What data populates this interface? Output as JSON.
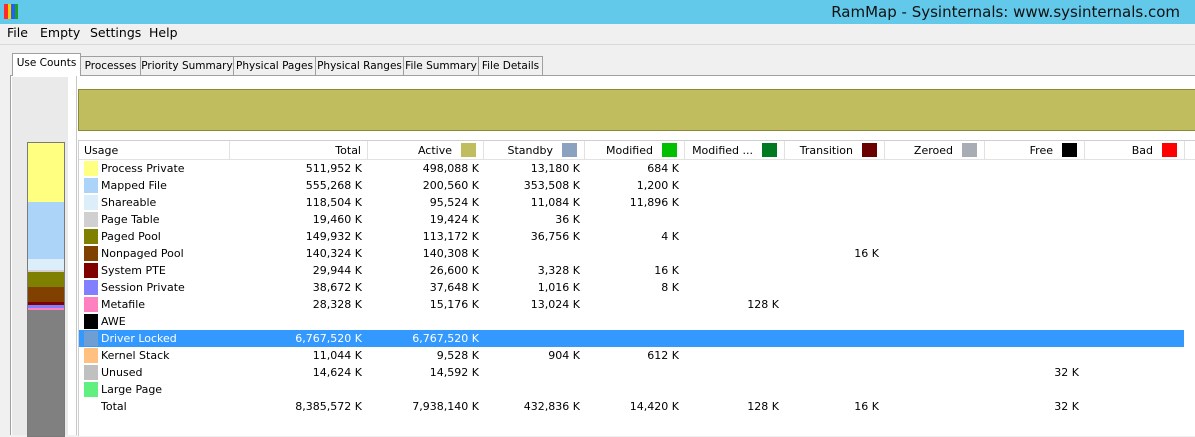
{
  "app": {
    "title": "RamMap - Sysinternals: www.sysinternals.com",
    "icon_colors": [
      "#ff2a2a",
      "#f5d000",
      "#2060ff",
      "#20a020"
    ]
  },
  "menu": [
    "File",
    "Empty",
    "Settings",
    "Help"
  ],
  "tabs": [
    {
      "label": "Use Counts",
      "active": true
    },
    {
      "label": "Processes"
    },
    {
      "label": "Priority Summary"
    },
    {
      "label": "Physical Pages"
    },
    {
      "label": "Physical Ranges"
    },
    {
      "label": "File Summary"
    },
    {
      "label": "File Details"
    }
  ],
  "columns": [
    {
      "label": "Usage"
    },
    {
      "label": "Total"
    },
    {
      "label": "Active",
      "color": "#bfbd5e"
    },
    {
      "label": "Standby",
      "color": "#8aa2c0"
    },
    {
      "label": "Modified",
      "color": "#00c000"
    },
    {
      "label": "Modified ...",
      "color": "#007a20"
    },
    {
      "label": "Transition",
      "color": "#6a0000"
    },
    {
      "label": "Zeroed",
      "color": "#a8acb4"
    },
    {
      "label": "Free",
      "color": "#000000"
    },
    {
      "label": "Bad",
      "color": "#ff0000"
    }
  ],
  "rows": [
    {
      "label": "Process Private",
      "color": "#ffff80",
      "values": [
        "511,952 K",
        "498,088 K",
        "13,180 K",
        "684 K",
        "",
        "",
        "",
        "",
        ""
      ]
    },
    {
      "label": "Mapped File",
      "color": "#acd4f8",
      "values": [
        "555,268 K",
        "200,560 K",
        "353,508 K",
        "1,200 K",
        "",
        "",
        "",
        "",
        ""
      ]
    },
    {
      "label": "Shareable",
      "color": "#dceefa",
      "values": [
        "118,504 K",
        "95,524 K",
        "11,084 K",
        "11,896 K",
        "",
        "",
        "",
        "",
        ""
      ]
    },
    {
      "label": "Page Table",
      "color": "#d0d0d0",
      "values": [
        "19,460 K",
        "19,424 K",
        "36 K",
        "",
        "",
        "",
        "",
        "",
        ""
      ]
    },
    {
      "label": "Paged Pool",
      "color": "#808000",
      "values": [
        "149,932 K",
        "113,172 K",
        "36,756 K",
        "4 K",
        "",
        "",
        "",
        "",
        ""
      ]
    },
    {
      "label": "Nonpaged Pool",
      "color": "#804000",
      "values": [
        "140,324 K",
        "140,308 K",
        "",
        "",
        "",
        "16 K",
        "",
        "",
        ""
      ]
    },
    {
      "label": "System PTE",
      "color": "#800000",
      "values": [
        "29,944 K",
        "26,600 K",
        "3,328 K",
        "16 K",
        "",
        "",
        "",
        "",
        ""
      ]
    },
    {
      "label": "Session Private",
      "color": "#8080ff",
      "values": [
        "38,672 K",
        "37,648 K",
        "1,016 K",
        "8 K",
        "",
        "",
        "",
        "",
        ""
      ]
    },
    {
      "label": "Metafile",
      "color": "#ff80c0",
      "values": [
        "28,328 K",
        "15,176 K",
        "13,024 K",
        "",
        "128 K",
        "",
        "",
        "",
        ""
      ]
    },
    {
      "label": "AWE",
      "color": "#000000",
      "values": [
        "",
        "",
        "",
        "",
        "",
        "",
        "",
        "",
        ""
      ]
    },
    {
      "label": "Driver Locked",
      "color": "#6f9ed2",
      "selected": true,
      "values": [
        "6,767,520 K",
        "6,767,520 K",
        "",
        "",
        "",
        "",
        "",
        "",
        ""
      ]
    },
    {
      "label": "Kernel Stack",
      "color": "#ffc080",
      "values": [
        "11,044 K",
        "9,528 K",
        "904 K",
        "612 K",
        "",
        "",
        "",
        "",
        ""
      ]
    },
    {
      "label": "Unused",
      "color": "#c0c0c0",
      "values": [
        "14,624 K",
        "14,592 K",
        "",
        "",
        "",
        "",
        "",
        "32 K",
        ""
      ]
    },
    {
      "label": "Large Page",
      "color": "#60f080",
      "values": [
        "",
        "",
        "",
        "",
        "",
        "",
        "",
        "",
        ""
      ]
    },
    {
      "label": "Total",
      "color": "",
      "values": [
        "8,385,572 K",
        "7,938,140 K",
        "432,836 K",
        "14,420 K",
        "128 K",
        "16 K",
        "",
        "32 K",
        ""
      ]
    }
  ],
  "usage_bar": [
    {
      "label": "Process Private",
      "color": "#ffff80",
      "fraction": 0.2
    },
    {
      "label": "Mapped File",
      "color": "#acd4f8",
      "fraction": 0.196
    },
    {
      "label": "Shareable",
      "color": "#dceefa",
      "fraction": 0.038
    },
    {
      "label": "Page Table",
      "color": "#d0d0d0",
      "fraction": 0.007
    },
    {
      "label": "Paged Pool",
      "color": "#808000",
      "fraction": 0.051
    },
    {
      "label": "Nonpaged Pool",
      "color": "#804000",
      "fraction": 0.051
    },
    {
      "label": "System PTE",
      "color": "#800000",
      "fraction": 0.01
    },
    {
      "label": "Session Private",
      "color": "#8080ff",
      "fraction": 0.01
    },
    {
      "label": "Metafile",
      "color": "#ff80c0",
      "fraction": 0.007
    },
    {
      "label": "Driver Locked",
      "color": "#808080",
      "fraction": 0.43
    }
  ]
}
